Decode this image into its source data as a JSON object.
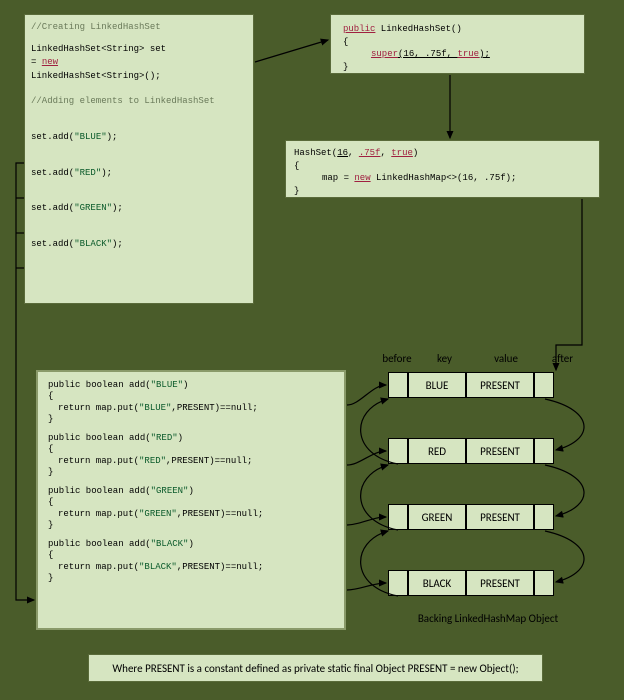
{
  "box1": {
    "comment1": "//Creating LinkedHashSet",
    "decl1a": "LinkedHashSet<String> set",
    "decl1b": "= ",
    "kw_new": "new",
    "decl1c": "LinkedHashSet<String>();",
    "comment2": "//Adding elements to LinkedHashSet",
    "add1a": "set.add(",
    "add1b": "\"BLUE\"",
    "add1c": ");",
    "add2a": "set.add(",
    "add2b": "\"RED\"",
    "add2c": ");",
    "add3a": "set.add(",
    "add3b": "\"GREEN\"",
    "add3c": ");",
    "add4a": "set.add(",
    "add4b": "\"BLACK\"",
    "add4c": ");"
  },
  "box2": {
    "sig1": "public",
    "sig2": " LinkedHashSet()",
    "brace_o": "{",
    "call1": "super",
    "call2": "(16, ",
    "call3": ".75f",
    "call4": ", ",
    "call5": "true",
    "call6": ");",
    "brace_c": "}"
  },
  "box3": {
    "sig1": "HashSet(",
    "sig2": "16",
    "sig3": ", ",
    "sig4": ".75f",
    "sig5": ", ",
    "sig6": "true",
    "sig7": ")",
    "brace_o": "{",
    "body1": "map = ",
    "kw_new": "new",
    "body2": " LinkedHashMap<>(16, .75f);",
    "brace_c": "}"
  },
  "box4": {
    "items": [
      {
        "color": "BLUE"
      },
      {
        "color": "RED"
      },
      {
        "color": "GREEN"
      },
      {
        "color": "BLACK"
      }
    ],
    "tpl_sig": "public boolean add(",
    "tpl_ret": "return map.put(",
    "tpl_ret2": ",PRESENT)==null;"
  },
  "headers": {
    "before": "before",
    "key": "key",
    "value": "value",
    "after": "after"
  },
  "rows": [
    {
      "key": "BLUE",
      "value": "PRESENT"
    },
    {
      "key": "RED",
      "value": "PRESENT"
    },
    {
      "key": "GREEN",
      "value": "PRESENT"
    },
    {
      "key": "BLACK",
      "value": "PRESENT"
    }
  ],
  "caption": "Backing LinkedHashMap Object",
  "footer": "Where PRESENT is a constant defined as private static final Object PRESENT = new Object();"
}
